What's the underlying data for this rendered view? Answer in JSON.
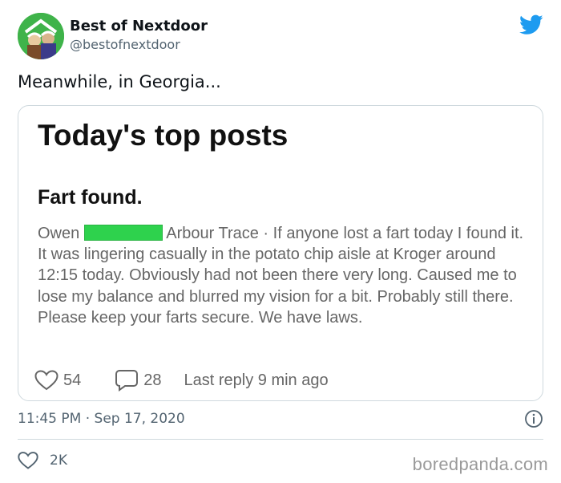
{
  "account": {
    "display_name": "Best of Nextdoor",
    "handle": "@bestofnextdoor",
    "avatar_icon": "nextdoor-house-avatar",
    "avatar_color": "#3fb34a"
  },
  "tweet": {
    "text": "Meanwhile, in Georgia...",
    "timestamp": "11:45 PM · Sep 17, 2020",
    "likes": "2K"
  },
  "screenshot_card": {
    "heading": "Today's top posts",
    "post_title": "Fart found.",
    "author_first": "Owen",
    "author_redaction_color": "#2ed24d",
    "location_and_body": "Arbour Trace · If anyone lost a fart today I found it. It was lingering casually in the potato chip aisle at Kroger around 12:15 today. Obviously had not been there very long. Caused me to lose my balance and blurred my vision for a bit. Probably still there. Please keep your farts secure. We have laws.",
    "thanks_count": "54",
    "reply_count": "28",
    "last_reply": "Last reply 9 min ago"
  },
  "brand": {
    "twitter_icon": "twitter-bird-icon",
    "twitter_color": "#1d9bf0"
  },
  "watermark": "boredpanda.com"
}
